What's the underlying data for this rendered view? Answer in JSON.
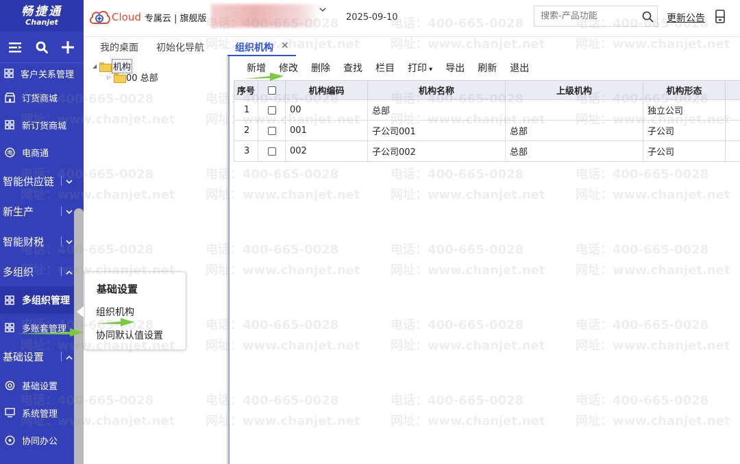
{
  "sidebar": {
    "logo_cn": "畅捷通",
    "logo_en": "Chanjet",
    "menu": [
      {
        "type": "item",
        "label": "客户关系管理",
        "icon": "apps-icon"
      },
      {
        "type": "item",
        "label": "订货商城",
        "icon": "store-icon"
      },
      {
        "type": "item",
        "label": "新订货商城",
        "icon": "apps-icon"
      },
      {
        "type": "item",
        "label": "电商通",
        "icon": "ecommerce-icon"
      },
      {
        "type": "group",
        "label": "智能供应链",
        "expanded": false
      },
      {
        "type": "group",
        "label": "新生产",
        "expanded": false
      },
      {
        "type": "group",
        "label": "智能财税",
        "expanded": false
      },
      {
        "type": "group",
        "label": "多组织",
        "expanded": true
      },
      {
        "type": "item",
        "label": "多组织管理",
        "icon": "apps-icon",
        "active": true
      },
      {
        "type": "item",
        "label": "多账套管理",
        "icon": "apps-icon"
      },
      {
        "type": "group",
        "label": "基础设置",
        "expanded": true
      },
      {
        "type": "item",
        "label": "基础设置",
        "icon": "settings-icon"
      },
      {
        "type": "item",
        "label": "系统管理",
        "icon": "monitor-icon"
      },
      {
        "type": "item",
        "label": "协同办公",
        "icon": "collab-icon"
      }
    ]
  },
  "header": {
    "brand_text": "Cloud",
    "edition": "专属云 | 旗舰版",
    "company_name_blurred": "",
    "date": "2025-09-10",
    "search_placeholder": "搜索-产品功能",
    "notice_link": "更新公告"
  },
  "tabs": [
    {
      "label": "我的桌面",
      "active": false
    },
    {
      "label": "初始化导航",
      "active": false
    },
    {
      "label": "组织机构",
      "active": true,
      "closable": true
    }
  ],
  "tree": {
    "root": "机构",
    "children": [
      {
        "label": "00 总部"
      }
    ]
  },
  "toolbar": {
    "buttons": [
      "新增",
      "修改",
      "删除",
      "查找",
      "栏目",
      "打印",
      "导出",
      "刷新",
      "退出"
    ]
  },
  "grid": {
    "columns": [
      "序号",
      "",
      "机构编码",
      "机构名称",
      "上级机构",
      "机构形态"
    ],
    "rows": [
      {
        "no": "1",
        "code": "00",
        "name": "总部",
        "parent": "",
        "form": "独立公司"
      },
      {
        "no": "2",
        "code": "001",
        "name": "子公司001",
        "parent": "总部",
        "form": "子公司"
      },
      {
        "no": "3",
        "code": "002",
        "name": "子公司002",
        "parent": "总部",
        "form": "子公司"
      }
    ]
  },
  "popup": {
    "title": "基础设置",
    "items": [
      "组织机构",
      "协同默认值设置"
    ]
  },
  "watermark": {
    "phone": "电话：400-665-0028",
    "site": "网址：www.chanjet.net"
  },
  "colors": {
    "sidebar_bg": "#3440b8",
    "accent": "#2b4fd8",
    "arrow": "#7ac943"
  }
}
